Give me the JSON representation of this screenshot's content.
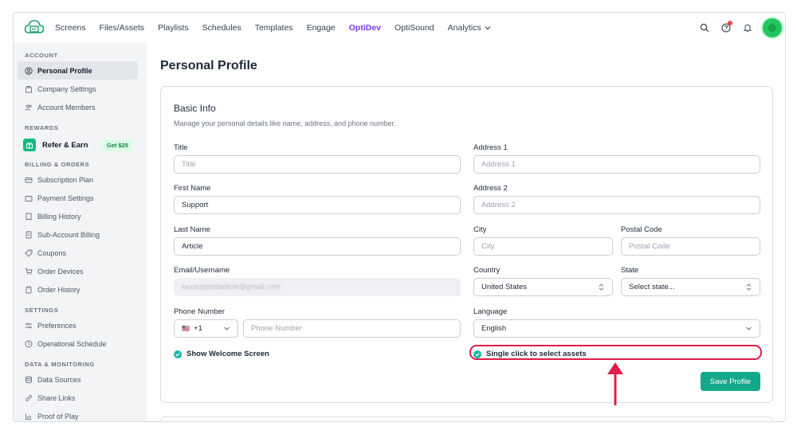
{
  "nav": {
    "items": [
      "Screens",
      "Files/Assets",
      "Playlists",
      "Schedules",
      "Templates",
      "Engage",
      "OptiDev",
      "OptiSound",
      "Analytics"
    ],
    "active": "OptiDev",
    "brand_color": "#7c3aed"
  },
  "sidebar": {
    "account_title": "ACCOUNT",
    "account_items": [
      "Personal Profile",
      "Company Settings",
      "Account Members"
    ],
    "rewards_title": "REWARDS",
    "refer_label": "Refer & Earn",
    "refer_badge": "Get $25",
    "billing_title": "BILLING & ORDERS",
    "billing_items": [
      "Subscription Plan",
      "Payment Settings",
      "Billing History",
      "Sub-Account Billing",
      "Coupons",
      "Order Devices",
      "Order History"
    ],
    "settings_title": "SETTINGS",
    "settings_items": [
      "Preferences",
      "Operational Schedule"
    ],
    "data_title": "DATA & MONITORING",
    "data_items": [
      "Data Sources",
      "Share Links",
      "Proof of Play"
    ]
  },
  "main": {
    "page_title": "Personal Profile",
    "card_title": "Basic Info",
    "card_desc": "Manage your personal details like name, address, and phone number.",
    "fields": {
      "title": {
        "label": "Title",
        "placeholder": "Title"
      },
      "first_name": {
        "label": "First Name",
        "value": "Support"
      },
      "last_name": {
        "label": "Last Name",
        "value": "Article"
      },
      "email": {
        "label": "Email/Username",
        "value": "xxxsupportarticle@gmail.com"
      },
      "phone": {
        "label": "Phone Number",
        "code": "+1",
        "flag": "🇺🇸",
        "placeholder": "Phone Number"
      },
      "address1": {
        "label": "Address 1",
        "placeholder": "Address 1"
      },
      "address2": {
        "label": "Address 2",
        "placeholder": "Address 2"
      },
      "city": {
        "label": "City",
        "placeholder": "City"
      },
      "postal": {
        "label": "Postal Code",
        "placeholder": "Postal Code"
      },
      "country": {
        "label": "Country",
        "value": "United States"
      },
      "state": {
        "label": "State",
        "value": "Select state..."
      },
      "language": {
        "label": "Language",
        "value": "English"
      }
    },
    "show_welcome": "Show Welcome Screen",
    "single_click": "Single click to select assets",
    "save_label": "Save Profile",
    "accent": "#14a88a",
    "highlight_color": "#e11d48"
  }
}
